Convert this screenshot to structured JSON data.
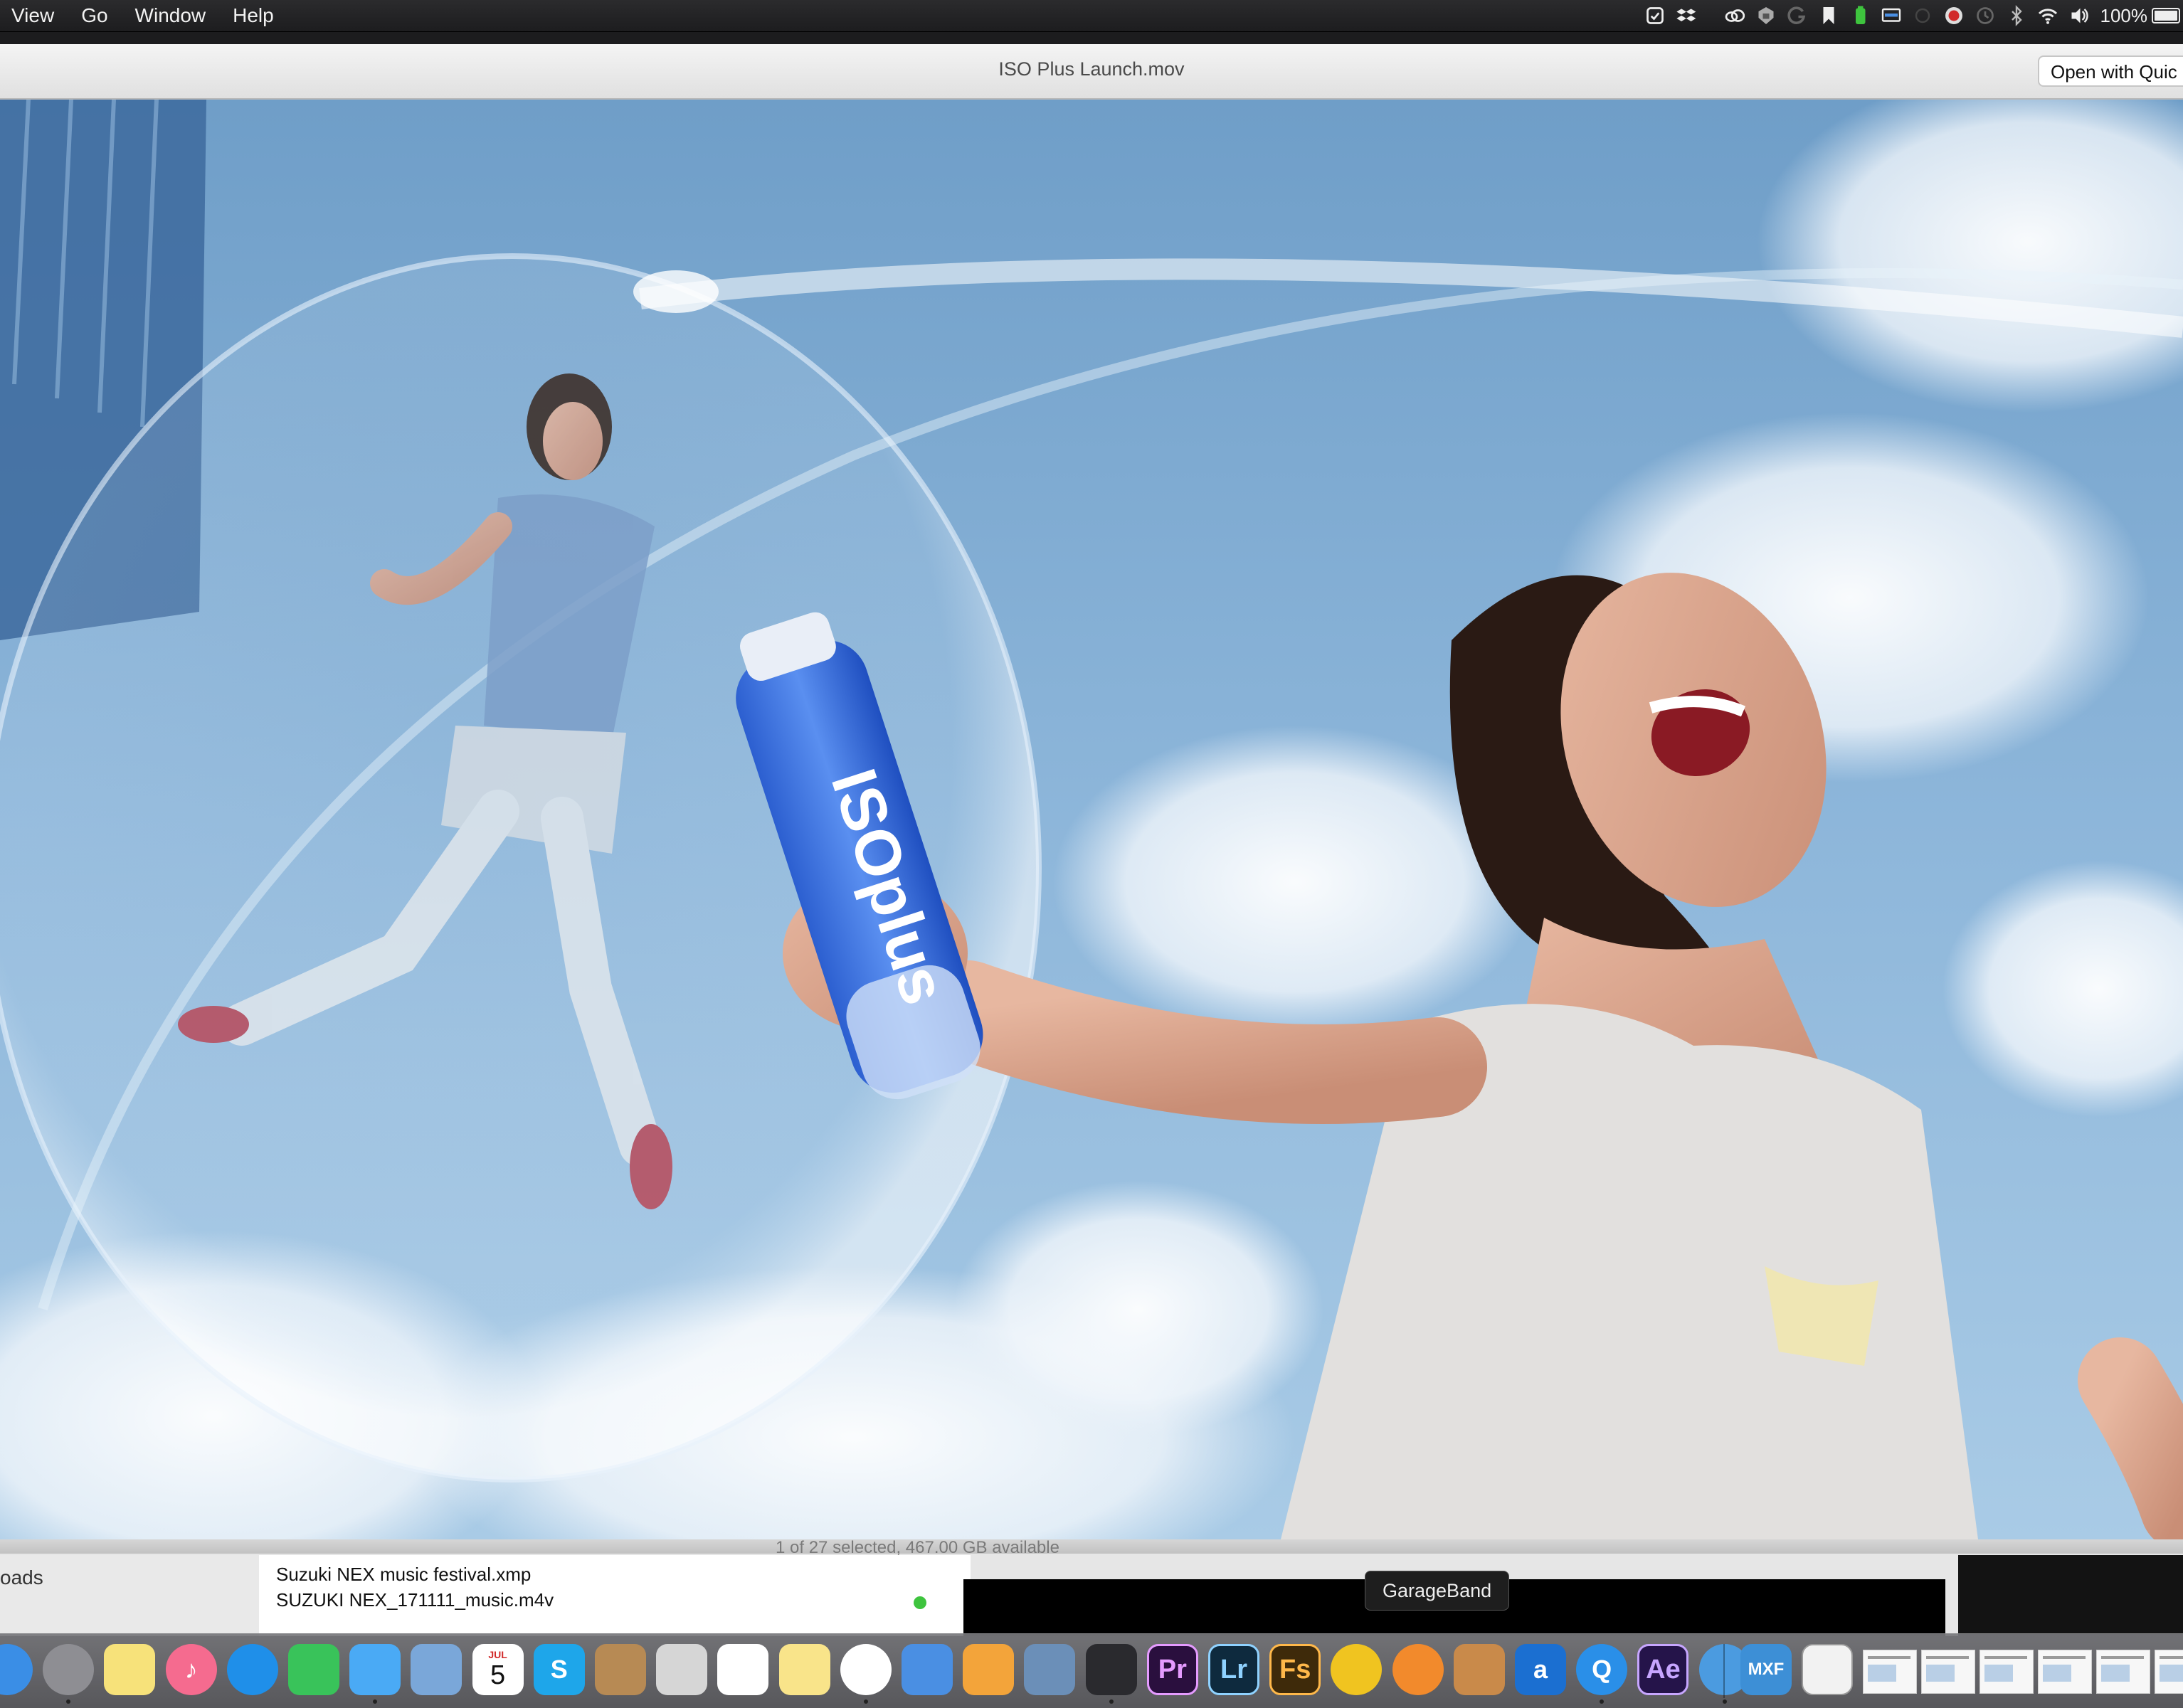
{
  "menubar": {
    "items": [
      "View",
      "Go",
      "Window",
      "Help"
    ],
    "status_icons": [
      "sync-icon",
      "dropbox-icon",
      "creative-cloud-icon",
      "vpn-icon",
      "grammarly-icon",
      "bookmark-icon",
      "battery-guard-icon",
      "display-icon",
      "blank-circle-icon",
      "record-icon",
      "time-machine-icon",
      "bluetooth-icon",
      "wifi-icon",
      "volume-icon"
    ],
    "battery_percent": "100%"
  },
  "quicklook": {
    "title": "ISO Plus Launch.mov",
    "open_with_label": "Open with Quic"
  },
  "video": {
    "bottle_text": "ISOplus"
  },
  "finder": {
    "status_text": "1 of 27 selected, 467.00 GB available",
    "sidebar_partial_label": "oads",
    "files": [
      "Suzuki NEX music festival.xmp",
      "SUZUKI NEX_171111_music.m4v"
    ]
  },
  "tooltip": {
    "text": "GarageBand"
  },
  "dock": {
    "calendar_month": "JUL",
    "calendar_day": "5",
    "apps": [
      {
        "name": "Finder",
        "icon": "finder-icon",
        "color": "#3a8ee6",
        "label": ""
      },
      {
        "name": "System Preferences",
        "icon": "system-preferences-icon",
        "color": "#8e8e93",
        "label": ""
      },
      {
        "name": "Stickies",
        "icon": "stickies-icon",
        "color": "#f7e27a",
        "label": ""
      },
      {
        "name": "iTunes",
        "icon": "itunes-icon",
        "color": "#f56b8f",
        "label": "♪"
      },
      {
        "name": "Safari",
        "icon": "safari-icon",
        "color": "#1f8fe9",
        "label": ""
      },
      {
        "name": "FaceTime",
        "icon": "facetime-icon",
        "color": "#39c35a",
        "label": ""
      },
      {
        "name": "Messages",
        "icon": "messages-icon",
        "color": "#4aaaf5",
        "label": ""
      },
      {
        "name": "Preview",
        "icon": "preview-icon",
        "color": "#7aa7d9",
        "label": ""
      },
      {
        "name": "Calendar",
        "icon": "calendar-icon",
        "color": "#ffffff",
        "label": ""
      },
      {
        "name": "Skype",
        "icon": "skype-icon",
        "color": "#1ea6ea",
        "label": "S"
      },
      {
        "name": "Contacts",
        "icon": "contacts-icon",
        "color": "#b78a54",
        "label": ""
      },
      {
        "name": "Image Capture",
        "icon": "image-capture-icon",
        "color": "#d6d6d6",
        "label": ""
      },
      {
        "name": "Reminders",
        "icon": "reminders-icon",
        "color": "#ffffff",
        "label": ""
      },
      {
        "name": "Notes",
        "icon": "notes-icon",
        "color": "#f9e48a",
        "label": ""
      },
      {
        "name": "Photos",
        "icon": "photos-icon",
        "color": "#ffffff",
        "label": ""
      },
      {
        "name": "Keynote",
        "icon": "keynote-icon",
        "color": "#4a8fe3",
        "label": ""
      },
      {
        "name": "Pages",
        "icon": "pages-icon",
        "color": "#f3a43a",
        "label": ""
      },
      {
        "name": "Photo Browser",
        "icon": "photo-browser-icon",
        "color": "#6b8fb8",
        "label": ""
      },
      {
        "name": "DaVinci Resolve",
        "icon": "davinci-resolve-icon",
        "color": "#2a2a2e",
        "label": ""
      },
      {
        "name": "Premiere Pro",
        "icon": "premiere-pro-icon",
        "color": "#2a0f3e",
        "label": "Pr"
      },
      {
        "name": "Lightroom",
        "icon": "lightroom-icon",
        "color": "#0e2a3e",
        "label": "Lr"
      },
      {
        "name": "Fireworks",
        "icon": "fireworks-icon",
        "color": "#3e2a0a",
        "label": "Fs"
      },
      {
        "name": "Cyberduck",
        "icon": "cyberduck-icon",
        "color": "#f0c420",
        "label": ""
      },
      {
        "name": "Final Cut Pro",
        "icon": "final-cut-icon",
        "color": "#f28a2c",
        "label": ""
      },
      {
        "name": "GarageBand",
        "icon": "garageband-icon",
        "color": "#c98a4a",
        "label": ""
      },
      {
        "name": "Amazon Photos",
        "icon": "amazon-icon",
        "color": "#1b6fd1",
        "label": "a"
      },
      {
        "name": "QuickTime Player",
        "icon": "quicktime-icon",
        "color": "#2a8fe8",
        "label": "Q"
      },
      {
        "name": "After Effects",
        "icon": "after-effects-icon",
        "color": "#25144a",
        "label": "Ae"
      },
      {
        "name": "Camtasia",
        "icon": "camtasia-icon",
        "color": "#4b9be0",
        "label": ""
      }
    ],
    "right_items": [
      {
        "name": "MXF",
        "icon": "mxf-icon",
        "color": "#3d8fd6",
        "label": "MXF"
      },
      {
        "name": "Document",
        "icon": "document-icon",
        "color": "#f2f2f2",
        "label": ""
      }
    ]
  }
}
